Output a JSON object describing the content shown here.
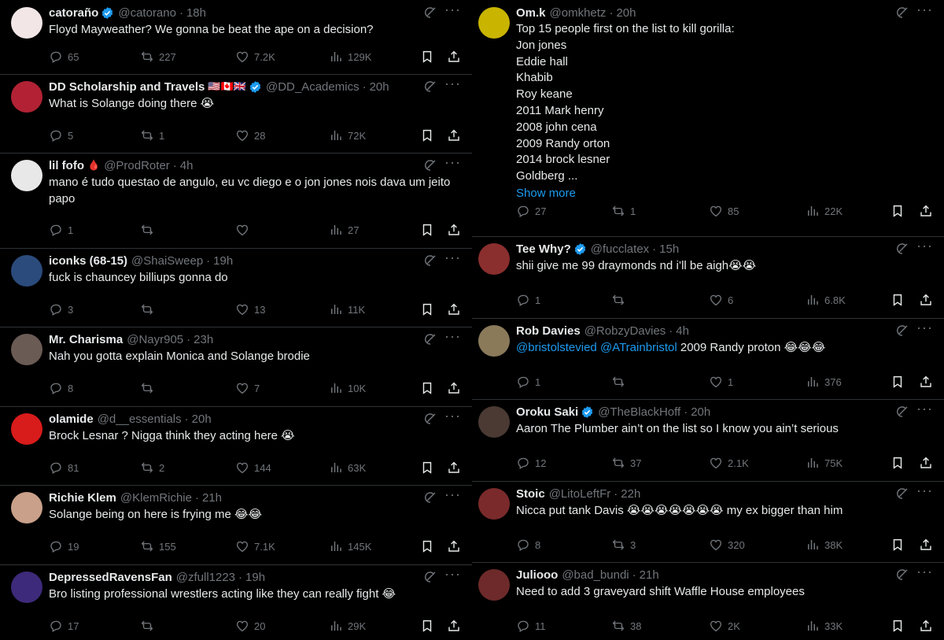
{
  "left": [
    {
      "name": "catoraño",
      "handle": "@catorano",
      "time": "18h",
      "verified": true,
      "flags": "",
      "avatar_color": "#f2e6e6",
      "avatar_text": "",
      "text_html": "Floyd Mayweather? We gonna be beat the ape on a decision?",
      "replies": "65",
      "retweets": "227",
      "likes": "7.2K",
      "views": "129K"
    },
    {
      "name": "DD Scholarship and Travels",
      "handle": "@DD_Academics",
      "time": "20h",
      "verified": true,
      "flags": "🇺🇸🇨🇦🇬🇧",
      "avatar_color": "#b22234",
      "avatar_text": "",
      "text_html": "What is Solange doing there 😭",
      "replies": "5",
      "retweets": "1",
      "likes": "28",
      "views": "72K"
    },
    {
      "name": "lil fofo",
      "handle": "@ProdRoter",
      "time": "4h",
      "verified": false,
      "flags": "🩸",
      "avatar_color": "#e8e8e8",
      "avatar_text": "",
      "text_html": "mano é tudo questao de angulo, eu vc diego e o jon jones nois dava um jeito papo",
      "replies": "1",
      "retweets": "",
      "likes": "",
      "views": "27"
    },
    {
      "name": "iconks (68-15)",
      "handle": "@ShaiSweep",
      "time": "19h",
      "verified": false,
      "flags": "",
      "avatar_color": "#2b4b7c",
      "avatar_text": "",
      "text_html": "fuck is chauncey billiups gonna do",
      "replies": "3",
      "retweets": "",
      "likes": "13",
      "views": "11K"
    },
    {
      "name": "Mr. Charisma",
      "handle": "@Nayr905",
      "time": "23h",
      "verified": false,
      "flags": "",
      "avatar_color": "#6b5b55",
      "avatar_text": "",
      "text_html": "Nah you gotta explain Monica and Solange brodie",
      "replies": "8",
      "retweets": "",
      "likes": "7",
      "views": "10K"
    },
    {
      "name": "olamide",
      "handle": "@d__essentials",
      "time": "20h",
      "verified": false,
      "flags": "",
      "avatar_color": "#d81b1b",
      "avatar_text": "",
      "text_html": "Brock Lesnar ? Nigga think they acting here 😭",
      "replies": "81",
      "retweets": "2",
      "likes": "144",
      "views": "63K"
    },
    {
      "name": "Richie Klem",
      "handle": "@KlemRichie",
      "time": "21h",
      "verified": false,
      "flags": "",
      "avatar_color": "#c9a08a",
      "avatar_text": "",
      "text_html": "Solange being on here is frying me 😂😂",
      "replies": "19",
      "retweets": "155",
      "likes": "7.1K",
      "views": "145K"
    },
    {
      "name": "DepressedRavensFan",
      "handle": "@zfull1223",
      "time": "19h",
      "verified": false,
      "flags": "",
      "avatar_color": "#3d2a7a",
      "avatar_text": "",
      "text_html": "Bro listing professional wrestlers acting like they can really fight 😂",
      "replies": "17",
      "retweets": "",
      "likes": "20",
      "views": "29K"
    }
  ],
  "right": [
    {
      "name": "Om.k",
      "handle": "@omkhetz",
      "time": "20h",
      "verified": false,
      "flags": "",
      "avatar_color": "#c9b400",
      "avatar_text": "",
      "intro": "Top 15 people first on the list to kill gorilla:",
      "list": [
        "Jon jones",
        "Eddie hall",
        "Khabib",
        "Roy keane",
        "2011 Mark henry",
        "2008 john cena",
        "2009 Randy orton",
        "2014 brock lesner",
        "Goldberg ..."
      ],
      "show_more": "Show more",
      "replies": "27",
      "retweets": "1",
      "likes": "85",
      "views": "22K"
    },
    {
      "name": "Tee Why?",
      "handle": "@fucclatex",
      "time": "15h",
      "verified": true,
      "flags": "",
      "avatar_color": "#8b2e2e",
      "avatar_text": "",
      "text_html": "shii give me 99 draymonds nd i’ll be aigh😭😭",
      "replies": "1",
      "retweets": "",
      "likes": "6",
      "views": "6.8K"
    },
    {
      "name": "Rob Davies",
      "handle": "@RobzyDavies",
      "time": "4h",
      "verified": false,
      "flags": "",
      "avatar_color": "#8a7a5a",
      "avatar_text": "",
      "mentions": [
        "@bristolstevied",
        "@ATrainbristol"
      ],
      "text_html": "2009 Randy proton 😂😂😂",
      "replies": "1",
      "retweets": "",
      "likes": "1",
      "views": "376"
    },
    {
      "name": "Oroku Saki",
      "handle": "@TheBlackHoff",
      "time": "20h",
      "verified": true,
      "flags": "",
      "avatar_color": "#4a3a33",
      "avatar_text": "",
      "text_html": "Aaron The Plumber ain’t on the list so I know you ain’t serious",
      "replies": "12",
      "retweets": "37",
      "likes": "2.1K",
      "views": "75K"
    },
    {
      "name": "Stoic",
      "handle": "@LitoLeftFr",
      "time": "22h",
      "verified": false,
      "flags": "",
      "avatar_color": "#7a2a2a",
      "avatar_text": "",
      "text_html": "Nicca put tank Davis 😭😭😭😭😭😭😭 my ex bigger than him",
      "replies": "8",
      "retweets": "3",
      "likes": "320",
      "views": "38K"
    },
    {
      "name": "Juliooo",
      "handle": "@bad_bundi",
      "time": "21h",
      "verified": false,
      "flags": "",
      "avatar_color": "#6e2a2a",
      "avatar_text": "",
      "text_html": "Need to add 3 graveyard shift Waffle House employees",
      "replies": "11",
      "retweets": "38",
      "likes": "2K",
      "views": "33K"
    }
  ],
  "icons": {
    "reply": "reply-icon",
    "retweet": "retweet-icon",
    "like": "like-icon",
    "views": "views-icon",
    "bookmark": "bookmark-icon",
    "share": "share-icon",
    "grok": "grok-icon",
    "more": "more-icon",
    "verified": "verified-badge-icon"
  },
  "colors": {
    "background": "#000000",
    "text": "#e7e9ea",
    "muted": "#71767b",
    "link": "#1d9bf0",
    "divider": "#2f3336"
  }
}
